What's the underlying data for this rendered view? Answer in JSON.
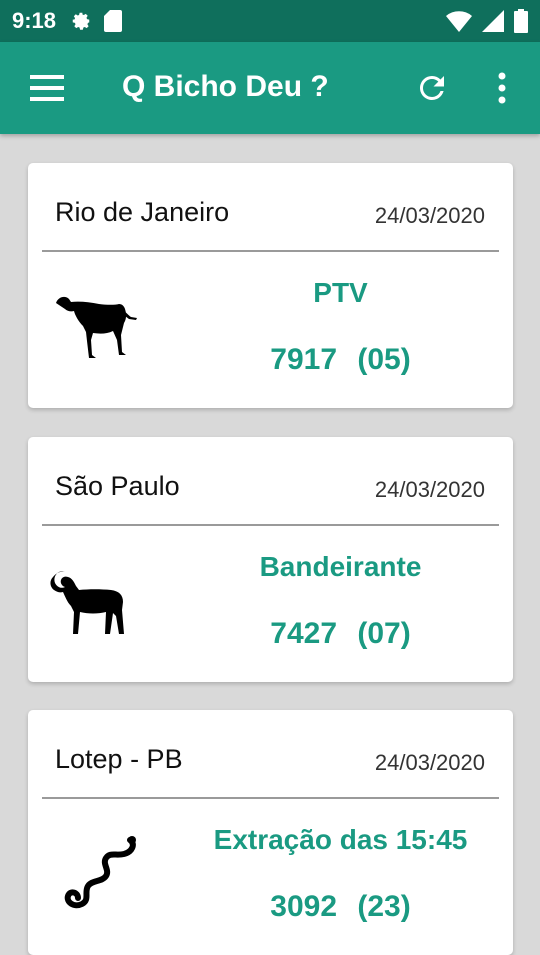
{
  "status_bar": {
    "time": "9:18",
    "icons": [
      "settings-icon",
      "sd-card-icon",
      "wifi-icon",
      "signal-icon",
      "battery-icon"
    ]
  },
  "app_bar": {
    "title": "Q Bicho Deu ?",
    "icons": [
      "menu-icon",
      "refresh-icon",
      "more-vert-icon"
    ],
    "color": "#1a9a82",
    "status_color": "#0f6f5c"
  },
  "results": [
    {
      "place": "Rio de Janeiro",
      "date": "24/03/2020",
      "draw": "PTV",
      "number": "7917",
      "group": "(05)",
      "animal_icon": "dog-icon"
    },
    {
      "place": "São Paulo",
      "date": "24/03/2020",
      "draw": "Bandeirante",
      "number": "7427",
      "group": "(07)",
      "animal_icon": "ram-icon"
    },
    {
      "place": "Lotep - PB",
      "date": "24/03/2020",
      "draw": "Extração das 15:45",
      "number": "3092",
      "group": "(23)",
      "animal_icon": "snake-icon"
    }
  ]
}
